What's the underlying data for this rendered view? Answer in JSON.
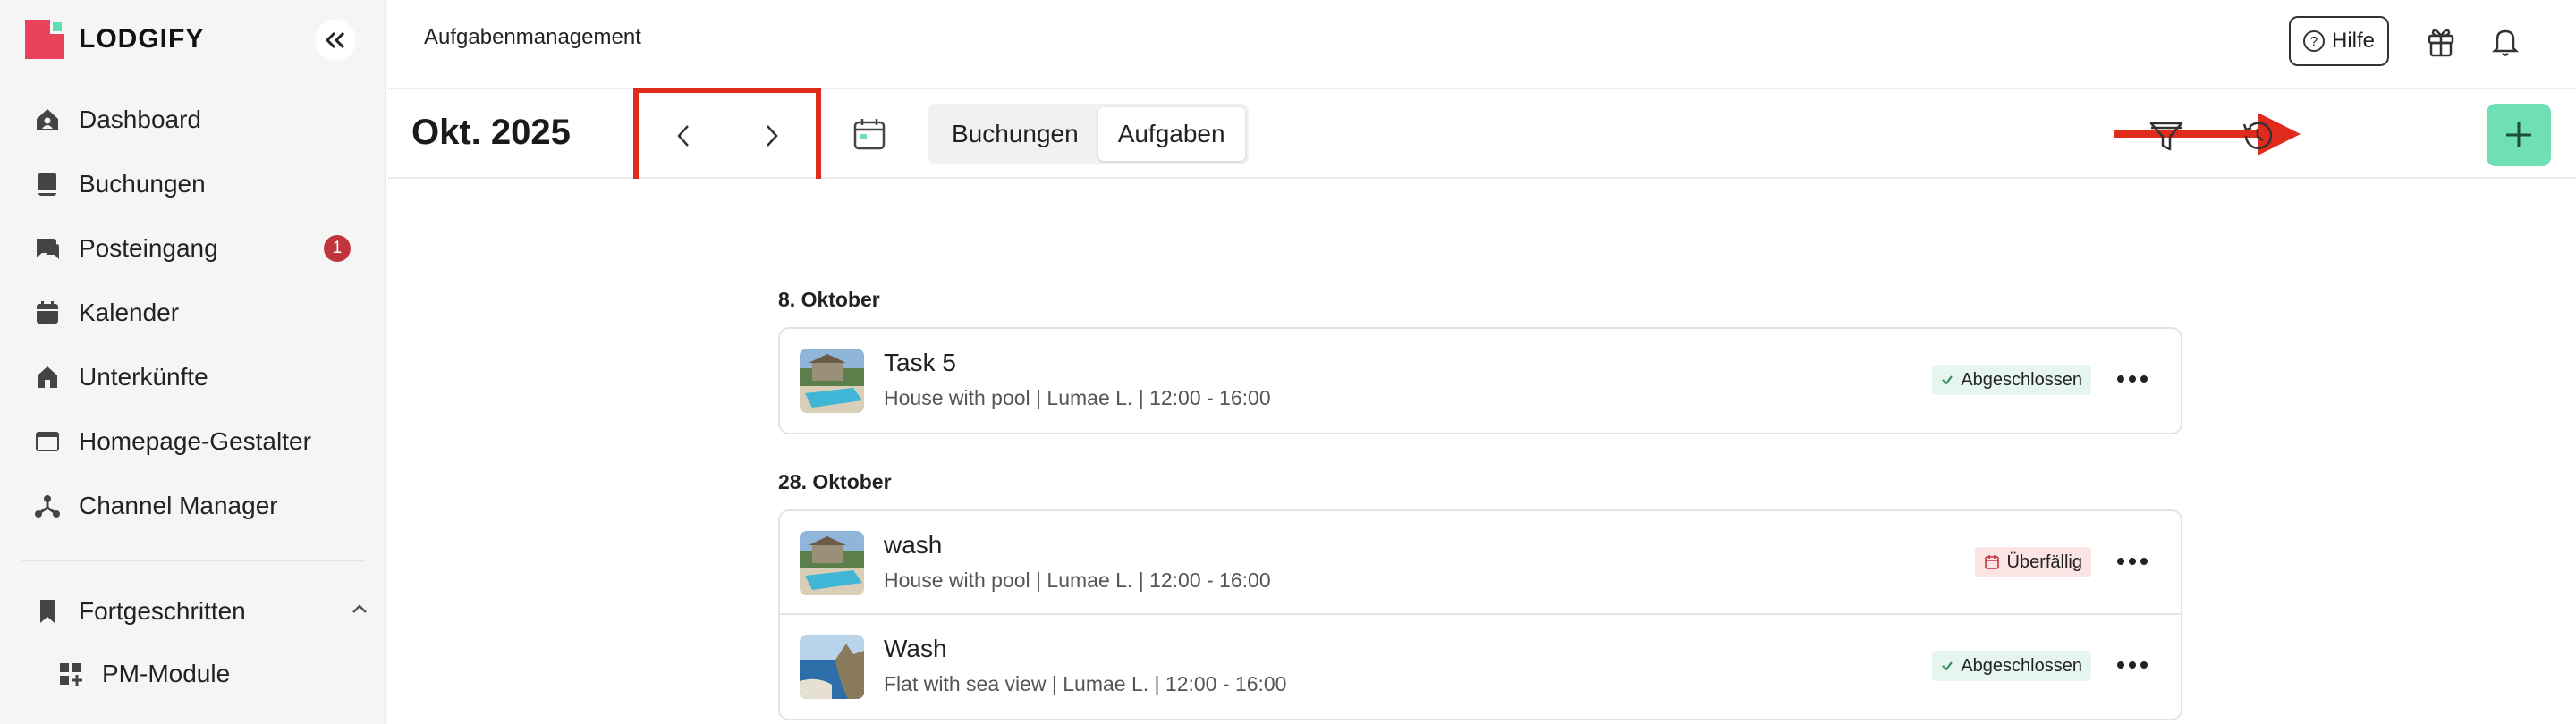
{
  "app": {
    "logo_text": "LODGIFY",
    "brand_color": "#e8435a",
    "accent_color": "#6ee0b4"
  },
  "sidebar": {
    "collapse_icon": "double-chevron-left-icon",
    "items": [
      {
        "label": "Dashboard",
        "icon": "home-icon"
      },
      {
        "label": "Buchungen",
        "icon": "book-icon"
      },
      {
        "label": "Posteingang",
        "icon": "chat-icon",
        "badge": "1"
      },
      {
        "label": "Kalender",
        "icon": "calendar-icon"
      },
      {
        "label": "Unterkünfte",
        "icon": "house-icon"
      },
      {
        "label": "Homepage-Gestalter",
        "icon": "browser-icon"
      },
      {
        "label": "Channel Manager",
        "icon": "network-icon"
      }
    ],
    "advanced": {
      "label": "Fortgeschritten",
      "icon": "bookmark-icon"
    },
    "sub_items": [
      {
        "label": "PM-Module",
        "icon": "grid-plus-icon"
      }
    ]
  },
  "header": {
    "title": "Aufgabenmanagement",
    "help_label": "Hilfe",
    "help_icon": "question-circle-icon"
  },
  "toolbar": {
    "month": "Okt. 2025",
    "segments": [
      "Buchungen",
      "Aufgaben"
    ],
    "active_segment": "Aufgaben"
  },
  "tasks": [
    {
      "date": "8. Oktober",
      "items": [
        {
          "name": "Task 5",
          "meta": "House with pool | Lumae L. | 12:00 - 16:00",
          "status": "Abgeschlossen",
          "status_type": "done",
          "thumb": "pool"
        }
      ]
    },
    {
      "date": "28. Oktober",
      "items": [
        {
          "name": "wash",
          "meta": "House with pool | Lumae L. | 12:00 - 16:00",
          "status": "Überfällig",
          "status_type": "overdue",
          "thumb": "pool"
        },
        {
          "name": "Wash",
          "meta": "Flat with sea view | Lumae L. | 12:00 - 16:00",
          "status": "Abgeschlossen",
          "status_type": "done",
          "thumb": "sea"
        }
      ]
    }
  ]
}
